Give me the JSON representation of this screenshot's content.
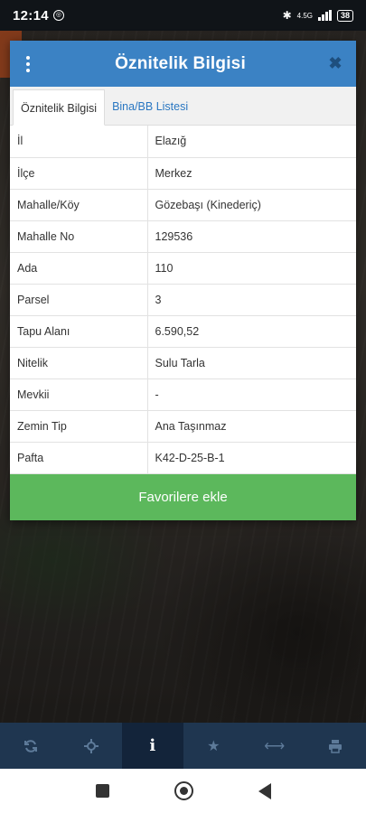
{
  "status_bar": {
    "time": "12:14",
    "network": "4.5G",
    "battery": "38"
  },
  "dialog": {
    "title": "Öznitelik Bilgisi",
    "tabs": [
      {
        "label": "Öznitelik Bilgisi",
        "active": true
      },
      {
        "label": "Bina/BB Listesi",
        "active": false
      }
    ],
    "rows": [
      {
        "key": "İl",
        "value": "Elazığ"
      },
      {
        "key": "İlçe",
        "value": "Merkez"
      },
      {
        "key": "Mahalle/Köy",
        "value": "Gözebaşı (Kinederiç)"
      },
      {
        "key": "Mahalle No",
        "value": "129536"
      },
      {
        "key": "Ada",
        "value": "110"
      },
      {
        "key": "Parsel",
        "value": "3"
      },
      {
        "key": "Tapu Alanı",
        "value": "6.590,52"
      },
      {
        "key": "Nitelik",
        "value": "Sulu Tarla"
      },
      {
        "key": "Mevkii",
        "value": "-"
      },
      {
        "key": "Zemin Tip",
        "value": "Ana Taşınmaz"
      },
      {
        "key": "Pafta",
        "value": "K42-D-25-B-1"
      }
    ],
    "favorite_label": "Favorilere ekle"
  },
  "toolbar": {
    "items": [
      "refresh-icon",
      "locate-icon",
      "info-icon",
      "star-icon",
      "measure-icon",
      "print-icon"
    ],
    "info_glyph": "i"
  },
  "colors": {
    "header": "#3b82c4",
    "favorite_button": "#5cb85c",
    "toolbar": "#1f3650",
    "tab_link": "#2a77c2"
  }
}
